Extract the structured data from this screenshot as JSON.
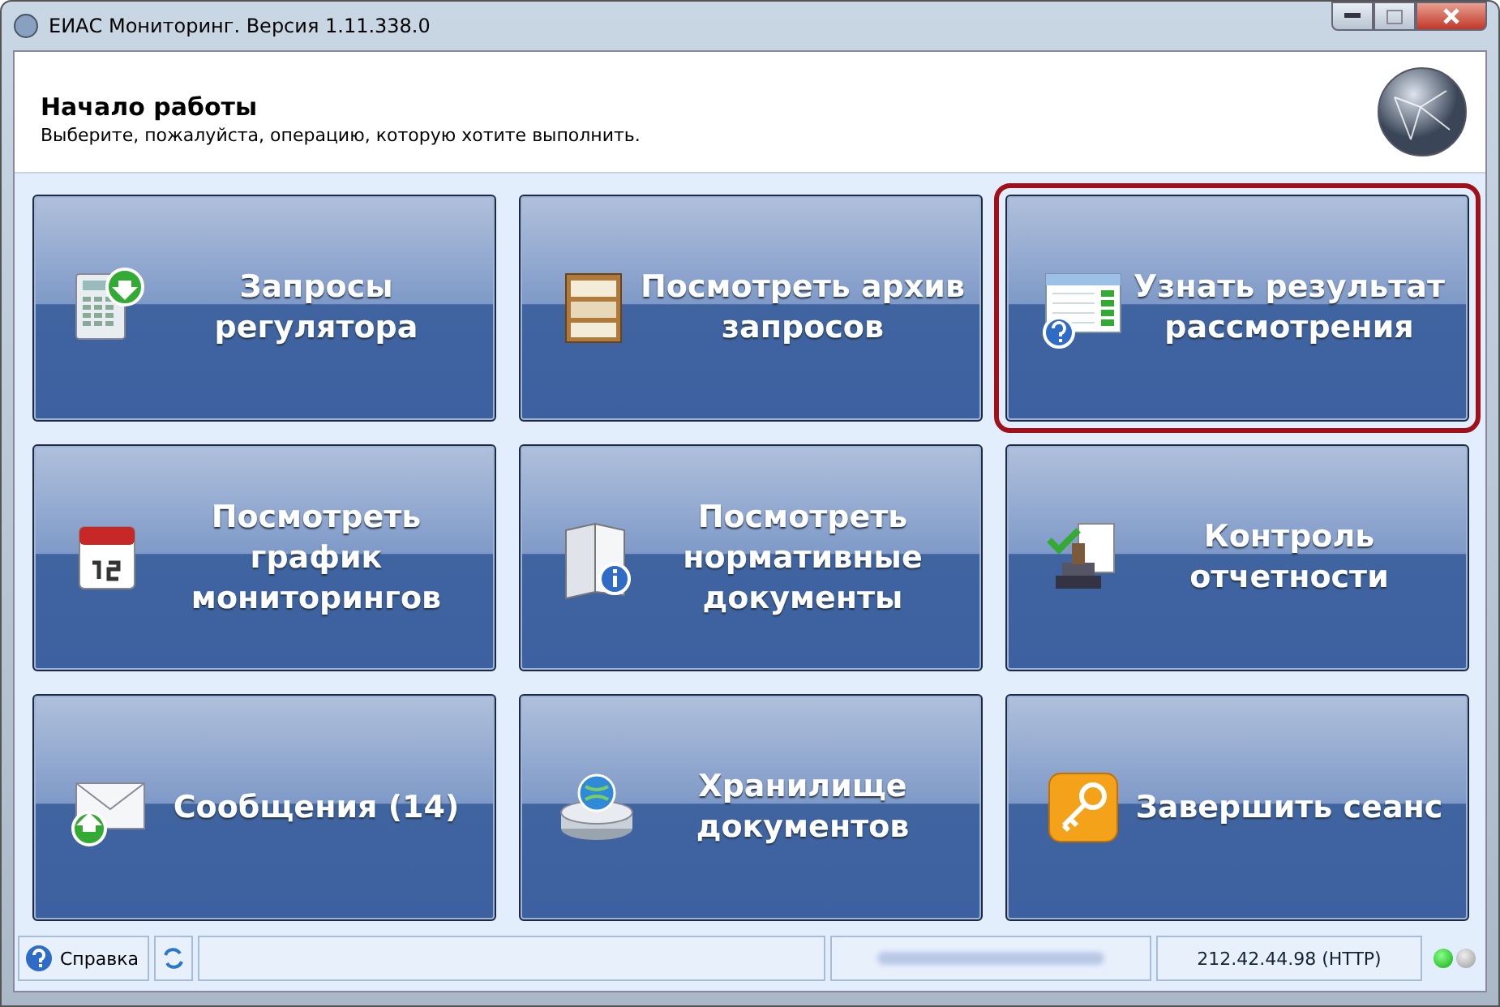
{
  "window": {
    "title": "ЕИАС Мониторинг. Версия 1.11.338.0"
  },
  "header": {
    "title": "Начало работы",
    "subtitle": "Выберите, пожалуйста, операцию, которую хотите выполнить."
  },
  "tiles": [
    {
      "label": "Запросы регулятора",
      "kind": "download",
      "selected": false
    },
    {
      "label": "Посмотреть архив запросов",
      "kind": "archive",
      "selected": false
    },
    {
      "label": "Узнать результат рассмотрения",
      "kind": "results",
      "selected": true
    },
    {
      "label": "Посмотреть график мониторингов",
      "kind": "calendar",
      "selected": false
    },
    {
      "label": "Посмотреть нормативные документы",
      "kind": "documents",
      "selected": false
    },
    {
      "label": "Контроль отчетности",
      "kind": "stamp",
      "selected": false
    },
    {
      "label": "Сообщения (14)",
      "kind": "mail",
      "selected": false
    },
    {
      "label": "Хранилище документов",
      "kind": "storage",
      "selected": false
    },
    {
      "label": "Завершить сеанс",
      "kind": "key",
      "selected": false
    }
  ],
  "status_bar": {
    "help": "Справка",
    "connection": "212.42.44.98 (HTTP)",
    "indicators": [
      {
        "on": true
      },
      {
        "on": false
      }
    ]
  }
}
